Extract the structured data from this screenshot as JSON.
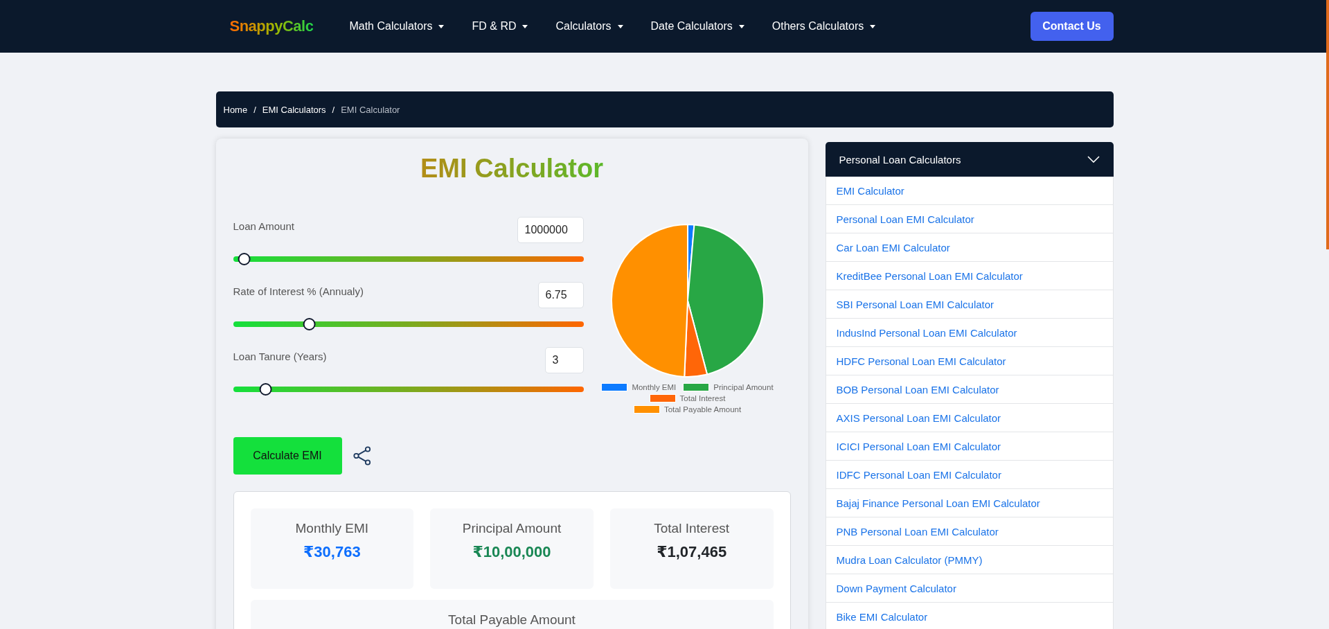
{
  "nav": {
    "logo": "SnappyCalc",
    "menus": [
      {
        "label": "Math Calculators"
      },
      {
        "label": "FD & RD"
      },
      {
        "label": "Calculators"
      },
      {
        "label": "Date Calculators"
      },
      {
        "label": "Others Calculators"
      }
    ],
    "contact_button": "Contact Us"
  },
  "breadcrumb": {
    "separator": "/",
    "items": [
      {
        "label": "Home",
        "current": false
      },
      {
        "label": "EMI Calculators",
        "current": false
      },
      {
        "label": "EMI Calculator",
        "current": true
      }
    ]
  },
  "calculator": {
    "title": "EMI Calculator",
    "inputs": [
      {
        "label": "Loan Amount",
        "value": "1000000",
        "level": 0.025
      },
      {
        "label": "Rate of Interest % (Annualy)",
        "value": "6.75",
        "level": 0.21
      },
      {
        "label": "Loan Tanure (Years)",
        "value": "3",
        "level": 0.085
      }
    ],
    "button": "Calculate EMI",
    "legend": [
      {
        "label": "Monthly EMI",
        "color": "#0d7bff"
      },
      {
        "label": "Principal Amount",
        "color": "#28a745"
      },
      {
        "label": "Total Interest",
        "color": "#ff6608"
      },
      {
        "label": "Total Payable Amount",
        "color": "#ff9000"
      }
    ]
  },
  "results": [
    {
      "label": "Monthly EMI",
      "value": "₹30,763",
      "color": "#0d6efd"
    },
    {
      "label": "Principal Amount",
      "value": "₹10,00,000",
      "color": "#198754"
    },
    {
      "label": "Total Interest",
      "value": "₹1,07,465",
      "color": "#212529"
    }
  ],
  "total_payable": {
    "label": "Total Payable Amount"
  },
  "sidebar": {
    "title": "Personal Loan Calculators",
    "expanded": true,
    "items": [
      "EMI Calculator",
      "Personal Loan EMI Calculator",
      "Car Loan EMI Calculator",
      "KreditBee Personal Loan EMI Calculator",
      "SBI Personal Loan EMI Calculator",
      "IndusInd Personal Loan EMI Calculator",
      "HDFC Personal Loan EMI Calculator",
      "BOB Personal Loan EMI Calculator",
      "AXIS Personal Loan EMI Calculator",
      "ICICI Personal Loan EMI Calculator",
      "IDFC Personal Loan EMI Calculator",
      "Bajaj Finance Personal Loan EMI Calculator",
      "PNB Personal Loan EMI Calculator",
      "Mudra Loan Calculator (PMMY)",
      "Down Payment Calculator",
      "Bike EMI Calculator"
    ]
  }
}
